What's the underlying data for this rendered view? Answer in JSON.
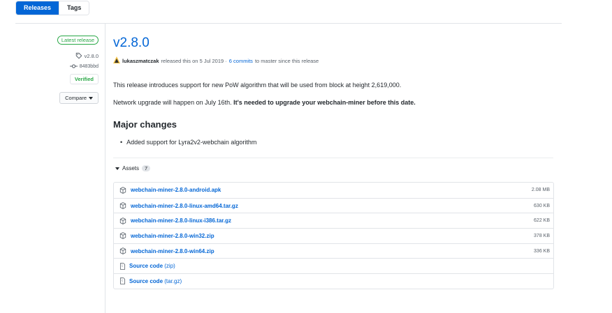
{
  "tabs": {
    "releases": "Releases",
    "tags": "Tags"
  },
  "meta": {
    "latest_label": "Latest release",
    "tag": "v2.8.0",
    "commit": "8483bbd",
    "verified": "Verified",
    "compare": "Compare"
  },
  "release": {
    "title": "v2.8.0",
    "author": "lukaszmatczak",
    "released_text": "released this on 5 Jul 2019 ·",
    "commits_link": "6 commits",
    "commits_suffix": "to master since this release",
    "para1": "This release introduces support for new PoW algorithm that will be used from block at height 2,619,000.",
    "para2_plain": "Network upgrade will happen on July 16th.",
    "para2_bold": "It's needed to upgrade your webchain-miner before this date.",
    "heading": "Major changes",
    "bullet": "Added support for Lyra2v2-webchain algorithm"
  },
  "assets": {
    "label": "Assets",
    "count": "7",
    "files": [
      {
        "name": "webchain-miner-2.8.0-android.apk",
        "size": "2.08 MB"
      },
      {
        "name": "webchain-miner-2.8.0-linux-amd64.tar.gz",
        "size": "630 KB"
      },
      {
        "name": "webchain-miner-2.8.0-linux-i386.tar.gz",
        "size": "622 KB"
      },
      {
        "name": "webchain-miner-2.8.0-win32.zip",
        "size": "378 KB"
      },
      {
        "name": "webchain-miner-2.8.0-win64.zip",
        "size": "336 KB"
      }
    ],
    "sources": [
      {
        "label": "Source code",
        "ext": "(zip)"
      },
      {
        "label": "Source code",
        "ext": "(tar.gz)"
      }
    ]
  },
  "colors": {
    "accent": "#0366d6",
    "success": "#28a745",
    "border": "#e1e4e8"
  }
}
